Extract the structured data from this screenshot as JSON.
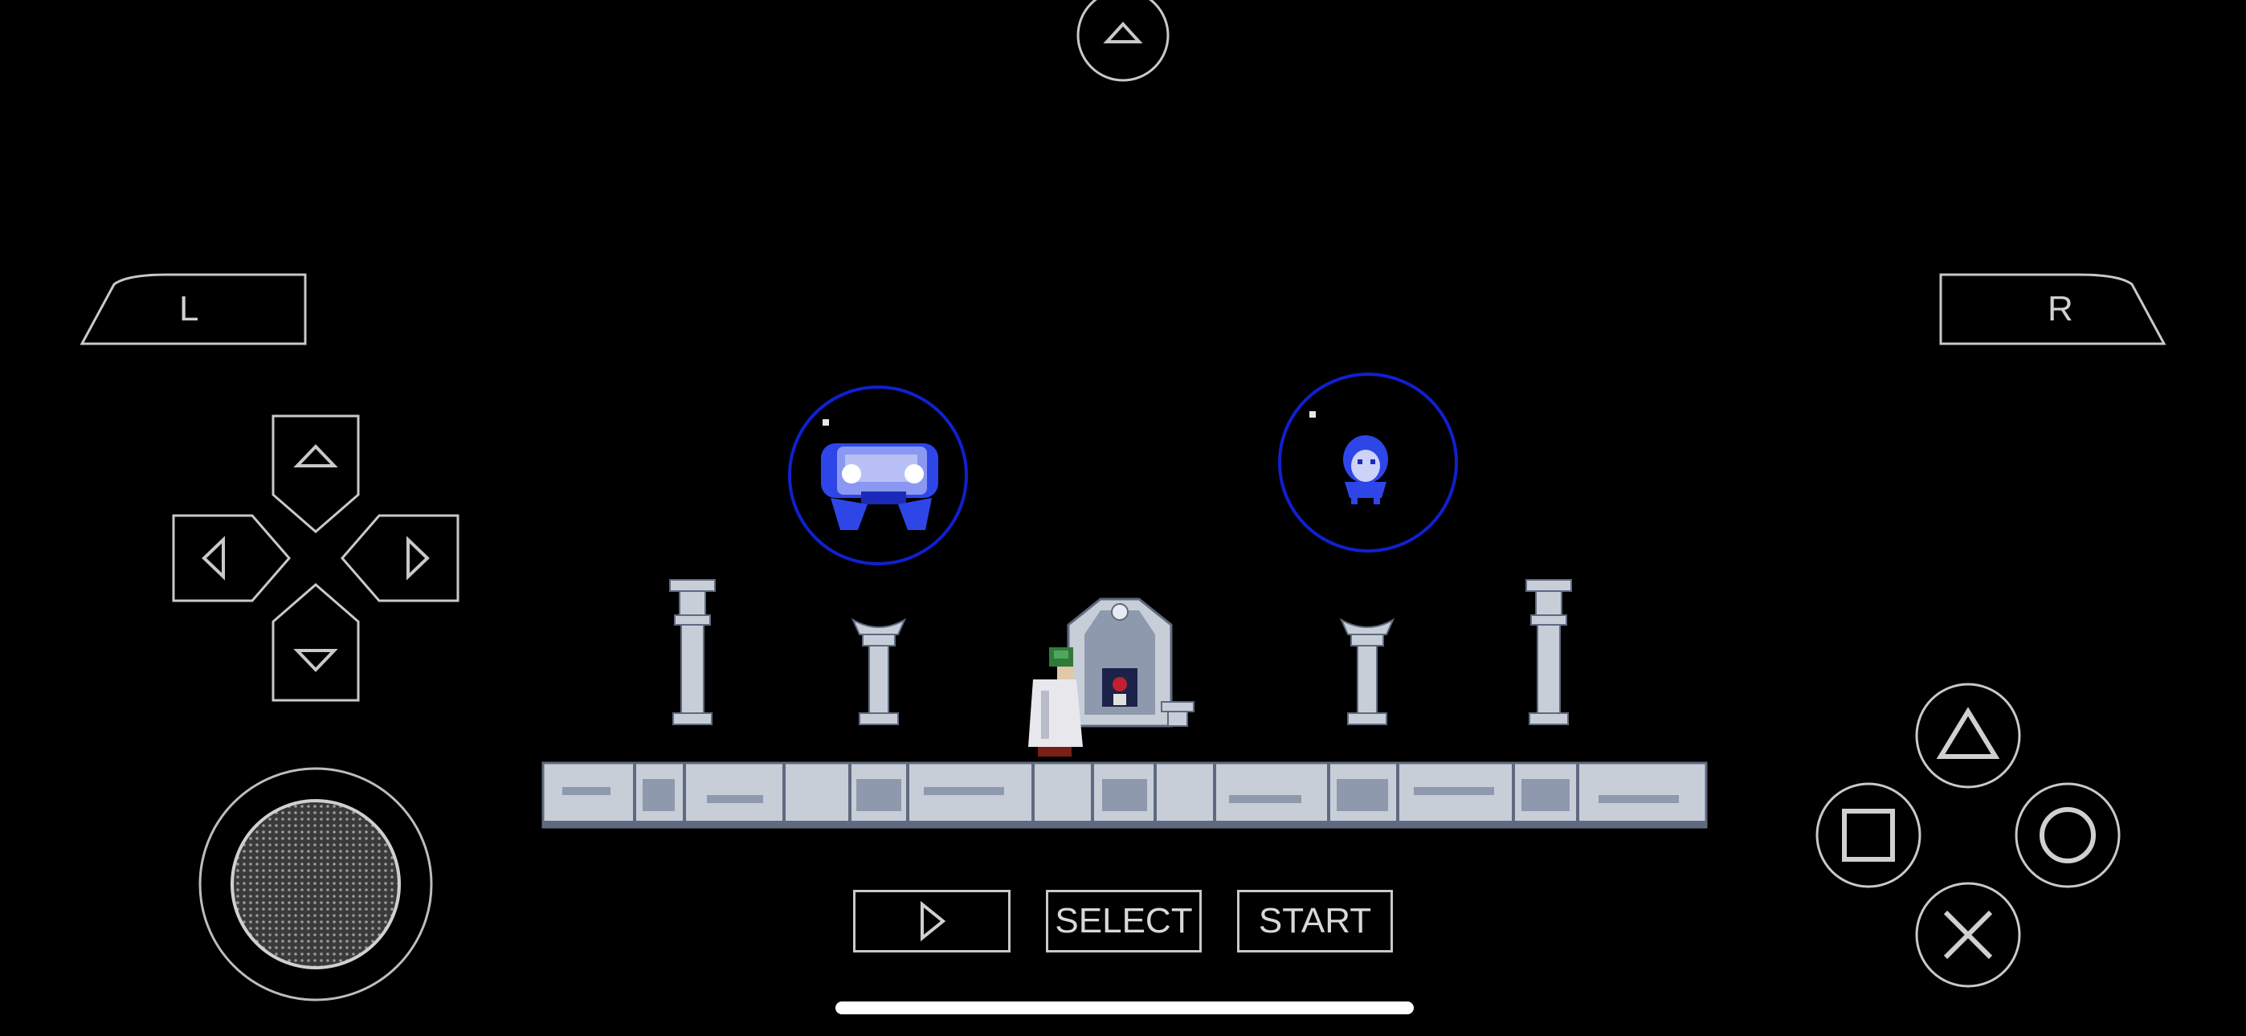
{
  "controls": {
    "l_label": "L",
    "r_label": "R",
    "select_label": "SELECT",
    "start_label": "START",
    "menu_icon": "chevron-up-icon",
    "play_icon": "play-icon",
    "dpad_icons": [
      "arrow-up-icon",
      "arrow-left-icon",
      "arrow-right-icon",
      "arrow-down-icon"
    ],
    "face_icons": [
      "triangle-icon",
      "square-icon",
      "circle-icon",
      "cross-icon"
    ]
  },
  "colors": {
    "control_stroke": "#c9c9c9",
    "bubble_ring": "#1020d0",
    "sprite_blue": "#2e46e8",
    "stone": "#c7ced8",
    "stone_dark": "#5f6a80"
  }
}
